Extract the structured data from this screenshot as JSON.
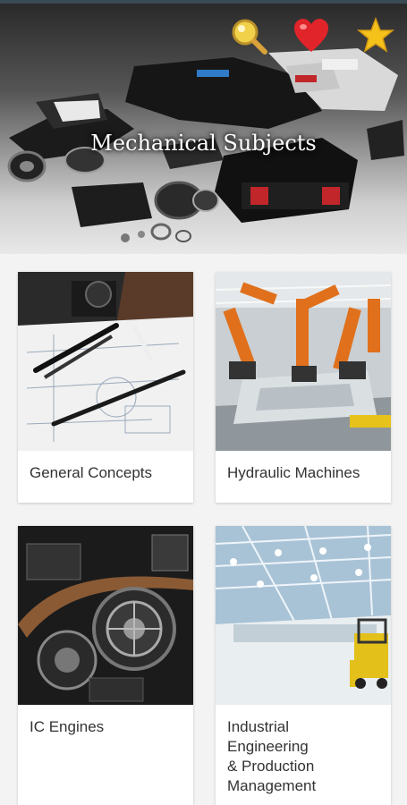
{
  "header": {
    "title": "Mechanical Subjects",
    "icons": [
      "search-icon",
      "heart-icon",
      "star-icon"
    ]
  },
  "subjects": [
    {
      "label": "General Concepts",
      "image": "technical-drawing-pens"
    },
    {
      "label": "Hydraulic Machines",
      "image": "robotic-assembly-line"
    },
    {
      "label": "IC Engines",
      "image": "engine-gears"
    },
    {
      "label": "Industrial\nEngineering\n& Production\nManagement",
      "image": "warehouse-forklift"
    }
  ],
  "colors": {
    "accent_heart": "#e0242a",
    "accent_star": "#f5c21b",
    "search_lens": "#f2d14a"
  }
}
